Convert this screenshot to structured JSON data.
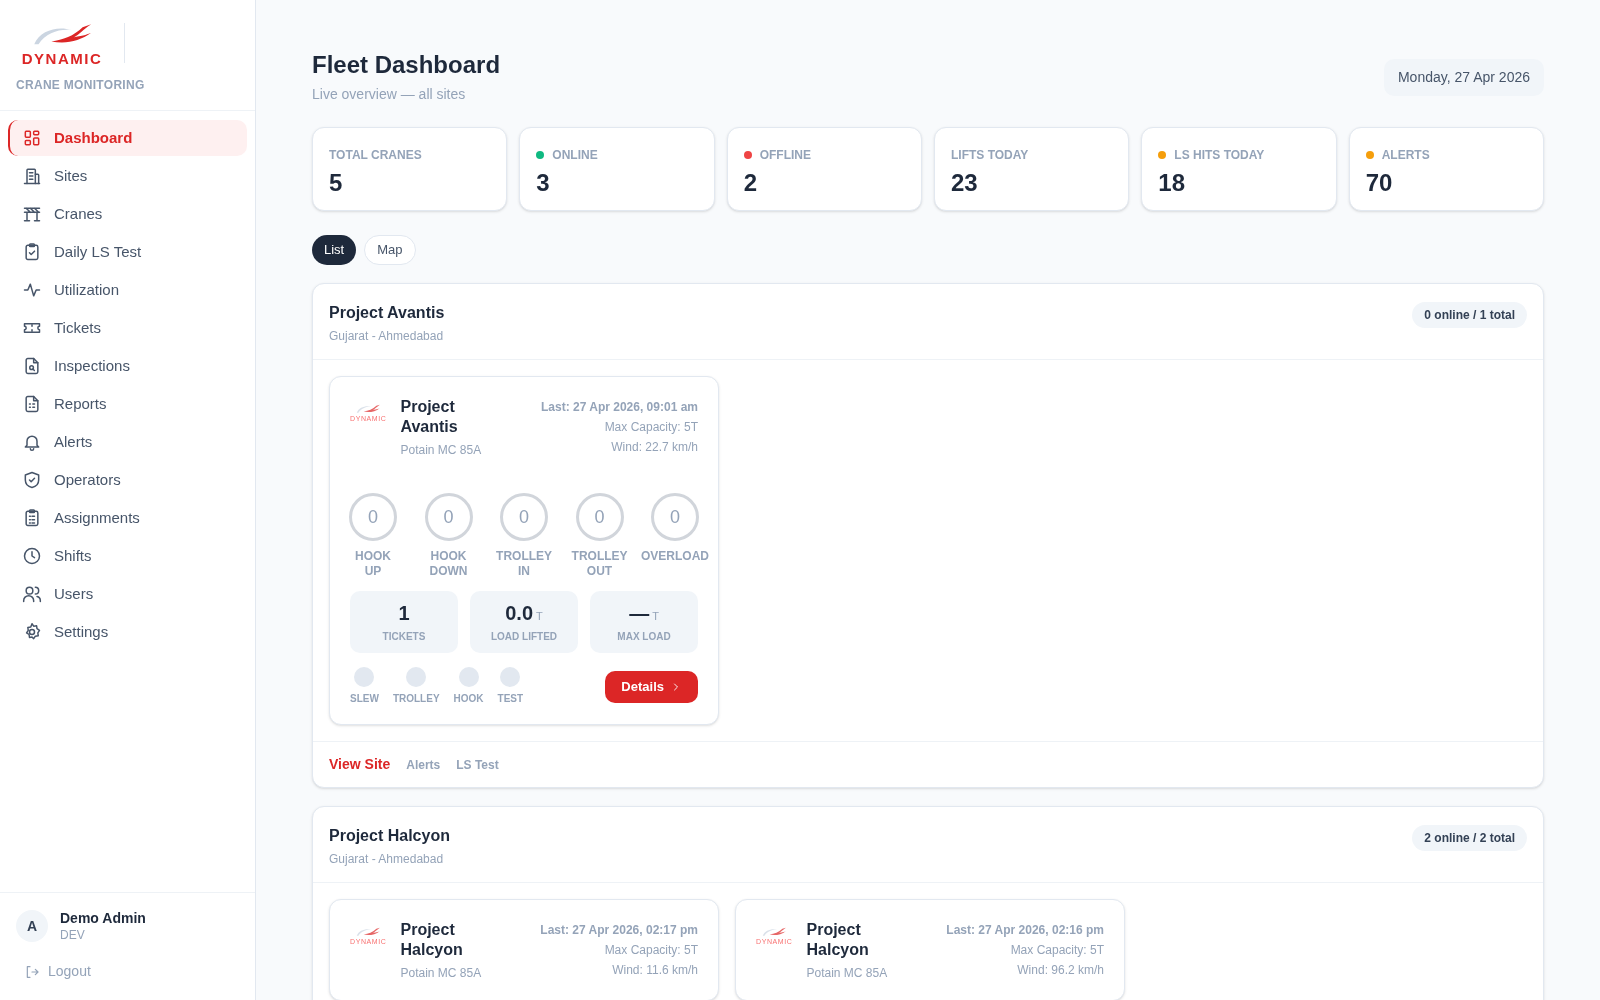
{
  "sidebar": {
    "logo_text": "DYNAMIC",
    "subtitle": "CRANE MONITORING",
    "items": [
      {
        "label": "Dashboard",
        "selected": true
      },
      {
        "label": "Sites",
        "selected": false
      },
      {
        "label": "Cranes",
        "selected": false
      },
      {
        "label": "Daily LS Test",
        "selected": false
      },
      {
        "label": "Utilization",
        "selected": false
      },
      {
        "label": "Tickets",
        "selected": false
      },
      {
        "label": "Inspections",
        "selected": false
      },
      {
        "label": "Reports",
        "selected": false
      },
      {
        "label": "Alerts",
        "selected": false
      },
      {
        "label": "Operators",
        "selected": false
      },
      {
        "label": "Assignments",
        "selected": false
      },
      {
        "label": "Shifts",
        "selected": false
      },
      {
        "label": "Users",
        "selected": false
      },
      {
        "label": "Settings",
        "selected": false
      }
    ],
    "user": {
      "initial": "A",
      "name": "Demo Admin",
      "role": "DEV"
    },
    "logout": "Logout"
  },
  "header": {
    "title": "Fleet Dashboard",
    "subtitle": "Live overview — all sites",
    "date": "Monday, 27 Apr 2026"
  },
  "stats": [
    {
      "label": "TOTAL CRANES",
      "value": "5"
    },
    {
      "label": "ONLINE",
      "value": "3",
      "color": "#10b981"
    },
    {
      "label": "OFFLINE",
      "value": "2",
      "color": "#ef4444"
    },
    {
      "label": "LIFTS TODAY",
      "value": "23"
    },
    {
      "label": "LS HITS TODAY",
      "value": "18",
      "color": "#f59e0b"
    },
    {
      "label": "ALERTS",
      "value": "70",
      "color": "#f59e0b"
    }
  ],
  "view_tabs": [
    {
      "label": "List",
      "selected": true
    },
    {
      "label": "Map",
      "selected": false
    }
  ],
  "sites": [
    {
      "name": "Project Avantis",
      "location": "Gujarat - Ahmedabad",
      "badge": "0 online / 1 total",
      "cranes": [
        {
          "logo_text": "DYNAMIC",
          "name": "Project Avantis",
          "model": "Potain MC 85A",
          "last": "Last: 27 Apr 2026, 09:01 am",
          "capacity": "Max Capacity: 5T",
          "wind": "Wind: 22.7 km/h",
          "counters": [
            {
              "value": "0",
              "label": "HOOK UP"
            },
            {
              "value": "0",
              "label": "HOOK DOWN"
            },
            {
              "value": "0",
              "label": "TROLLEY IN"
            },
            {
              "value": "0",
              "label": "TROLLEY OUT"
            },
            {
              "value": "0",
              "label": "OVERLOAD"
            }
          ],
          "metrics": [
            {
              "value": "1",
              "label": "TICKETS"
            },
            {
              "value": "0.0",
              "unit": "T",
              "label": "LOAD LIFTED"
            },
            {
              "value": "—",
              "unit": "T",
              "label": "MAX LOAD"
            }
          ],
          "indicators": [
            {
              "label": "SLEW",
              "on": false
            },
            {
              "label": "TROLLEY",
              "on": false
            },
            {
              "label": "HOOK",
              "on": false
            },
            {
              "label": "TEST",
              "on": false
            }
          ],
          "button": "Details"
        }
      ],
      "links": [
        {
          "label": "View Site",
          "selected": true
        },
        {
          "label": "Alerts",
          "selected": false
        },
        {
          "label": "LS Test",
          "selected": false
        }
      ]
    },
    {
      "name": "Project Halcyon",
      "location": "Gujarat - Ahmedabad",
      "badge": "2 online / 2 total",
      "cranes": [
        {
          "logo_text": "DYNAMIC",
          "name": "Project Halcyon",
          "model": "Potain MC 85A",
          "last": "Last: 27 Apr 2026, 02:17 pm",
          "capacity": "Max Capacity: 5T",
          "wind": "Wind: 11.6 km/h"
        },
        {
          "logo_text": "DYNAMIC",
          "name": "Project Halcyon",
          "model": "Potain MC 85A",
          "last": "Last: 27 Apr 2026, 02:16 pm",
          "capacity": "Max Capacity: 5T",
          "wind": "Wind: 96.2 km/h"
        }
      ]
    }
  ]
}
